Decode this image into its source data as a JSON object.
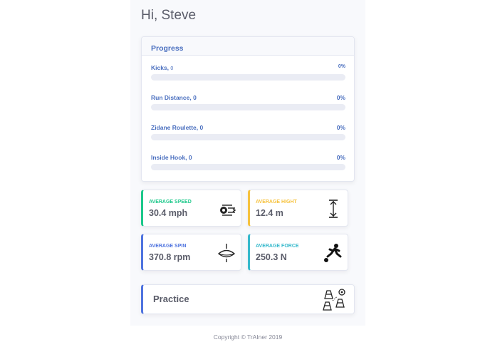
{
  "greeting": "Hi, Steve",
  "progress": {
    "title": "Progress",
    "items": [
      {
        "label": "Kicks,",
        "value": "0",
        "pct_text": "0%",
        "pct": 0
      },
      {
        "label": "Run Distance,",
        "value": "0",
        "pct_text": "0%",
        "pct": 0
      },
      {
        "label": "Zidane Roulette,",
        "value": "0",
        "pct_text": "0%",
        "pct": 0
      },
      {
        "label": "Inside Hook,",
        "value": "0",
        "pct_text": "0%",
        "pct": 0
      }
    ]
  },
  "stats": [
    {
      "title": "AVERAGE SPEED",
      "value": "30.4 mph",
      "color": "#1cc88a",
      "icon": "speed-icon"
    },
    {
      "title": "AVERAGE HIGHT",
      "value": "12.4 m",
      "color": "#f6c23e",
      "icon": "height-icon"
    },
    {
      "title": "AVERAGE SPIN",
      "value": "370.8 rpm",
      "color": "#4e73df",
      "icon": "spin-icon"
    },
    {
      "title": "AVERAGE FORCE",
      "value": "250.3 N",
      "color": "#36b9cc",
      "icon": "kick-icon"
    }
  ],
  "practice": {
    "label": "Practice",
    "icon": "training-cones-icon"
  },
  "footer": "Copyright © TrAIner 2019"
}
